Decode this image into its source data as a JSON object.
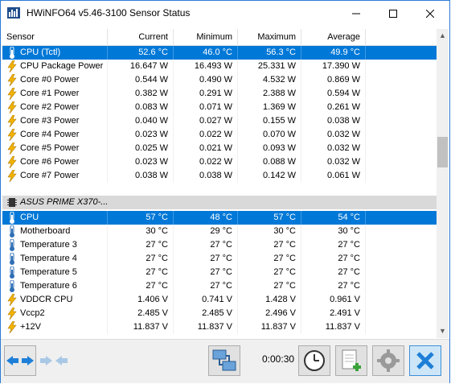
{
  "window": {
    "title": "HWiNFO64 v5.46-3100 Sensor Status"
  },
  "columns": {
    "sensor": "Sensor",
    "current": "Current",
    "minimum": "Minimum",
    "maximum": "Maximum",
    "average": "Average"
  },
  "rows": [
    {
      "icon": "thermometer-icon",
      "sensor": "CPU (Tctl)",
      "current": "52.6 °C",
      "minimum": "46.0 °C",
      "maximum": "56.3 °C",
      "average": "49.9 °C",
      "selected": true
    },
    {
      "icon": "lightning-icon",
      "sensor": "CPU Package Power",
      "current": "16.647 W",
      "minimum": "16.493 W",
      "maximum": "25.331 W",
      "average": "17.390 W"
    },
    {
      "icon": "lightning-icon",
      "sensor": "Core #0 Power",
      "current": "0.544 W",
      "minimum": "0.490 W",
      "maximum": "4.532 W",
      "average": "0.869 W"
    },
    {
      "icon": "lightning-icon",
      "sensor": "Core #1 Power",
      "current": "0.382 W",
      "minimum": "0.291 W",
      "maximum": "2.388 W",
      "average": "0.594 W"
    },
    {
      "icon": "lightning-icon",
      "sensor": "Core #2 Power",
      "current": "0.083 W",
      "minimum": "0.071 W",
      "maximum": "1.369 W",
      "average": "0.261 W"
    },
    {
      "icon": "lightning-icon",
      "sensor": "Core #3 Power",
      "current": "0.040 W",
      "minimum": "0.027 W",
      "maximum": "0.155 W",
      "average": "0.038 W"
    },
    {
      "icon": "lightning-icon",
      "sensor": "Core #4 Power",
      "current": "0.023 W",
      "minimum": "0.022 W",
      "maximum": "0.070 W",
      "average": "0.032 W"
    },
    {
      "icon": "lightning-icon",
      "sensor": "Core #5 Power",
      "current": "0.025 W",
      "minimum": "0.021 W",
      "maximum": "0.093 W",
      "average": "0.032 W"
    },
    {
      "icon": "lightning-icon",
      "sensor": "Core #6 Power",
      "current": "0.023 W",
      "minimum": "0.022 W",
      "maximum": "0.088 W",
      "average": "0.032 W"
    },
    {
      "icon": "lightning-icon",
      "sensor": "Core #7 Power",
      "current": "0.038 W",
      "minimum": "0.038 W",
      "maximum": "0.142 W",
      "average": "0.061 W"
    }
  ],
  "group": {
    "icon": "chip-icon",
    "label": "ASUS PRIME X370-..."
  },
  "rows2": [
    {
      "icon": "thermometer-icon",
      "sensor": "CPU",
      "current": "57 °C",
      "minimum": "48 °C",
      "maximum": "57 °C",
      "average": "54 °C",
      "selected": true
    },
    {
      "icon": "thermometer-icon",
      "sensor": "Motherboard",
      "current": "30 °C",
      "minimum": "29 °C",
      "maximum": "30 °C",
      "average": "30 °C"
    },
    {
      "icon": "thermometer-icon",
      "sensor": "Temperature 3",
      "current": "27 °C",
      "minimum": "27 °C",
      "maximum": "27 °C",
      "average": "27 °C"
    },
    {
      "icon": "thermometer-icon",
      "sensor": "Temperature 4",
      "current": "27 °C",
      "minimum": "27 °C",
      "maximum": "27 °C",
      "average": "27 °C"
    },
    {
      "icon": "thermometer-icon",
      "sensor": "Temperature 5",
      "current": "27 °C",
      "minimum": "27 °C",
      "maximum": "27 °C",
      "average": "27 °C"
    },
    {
      "icon": "thermometer-icon",
      "sensor": "Temperature 6",
      "current": "27 °C",
      "minimum": "27 °C",
      "maximum": "27 °C",
      "average": "27 °C"
    },
    {
      "icon": "lightning-icon",
      "sensor": "VDDCR CPU",
      "current": "1.406 V",
      "minimum": "0.741 V",
      "maximum": "1.428 V",
      "average": "0.961 V"
    },
    {
      "icon": "lightning-icon",
      "sensor": "Vccp2",
      "current": "2.485 V",
      "minimum": "2.485 V",
      "maximum": "2.496 V",
      "average": "2.491 V"
    },
    {
      "icon": "lightning-icon",
      "sensor": "+12V",
      "current": "11.837 V",
      "minimum": "11.837 V",
      "maximum": "11.837 V",
      "average": "11.837 V"
    }
  ],
  "toolbar": {
    "timer": "0:00:30"
  },
  "colors": {
    "selection": "#0078d7",
    "accent_blue": "#1e7fd8",
    "close_button_bg": "#cde6f7"
  }
}
